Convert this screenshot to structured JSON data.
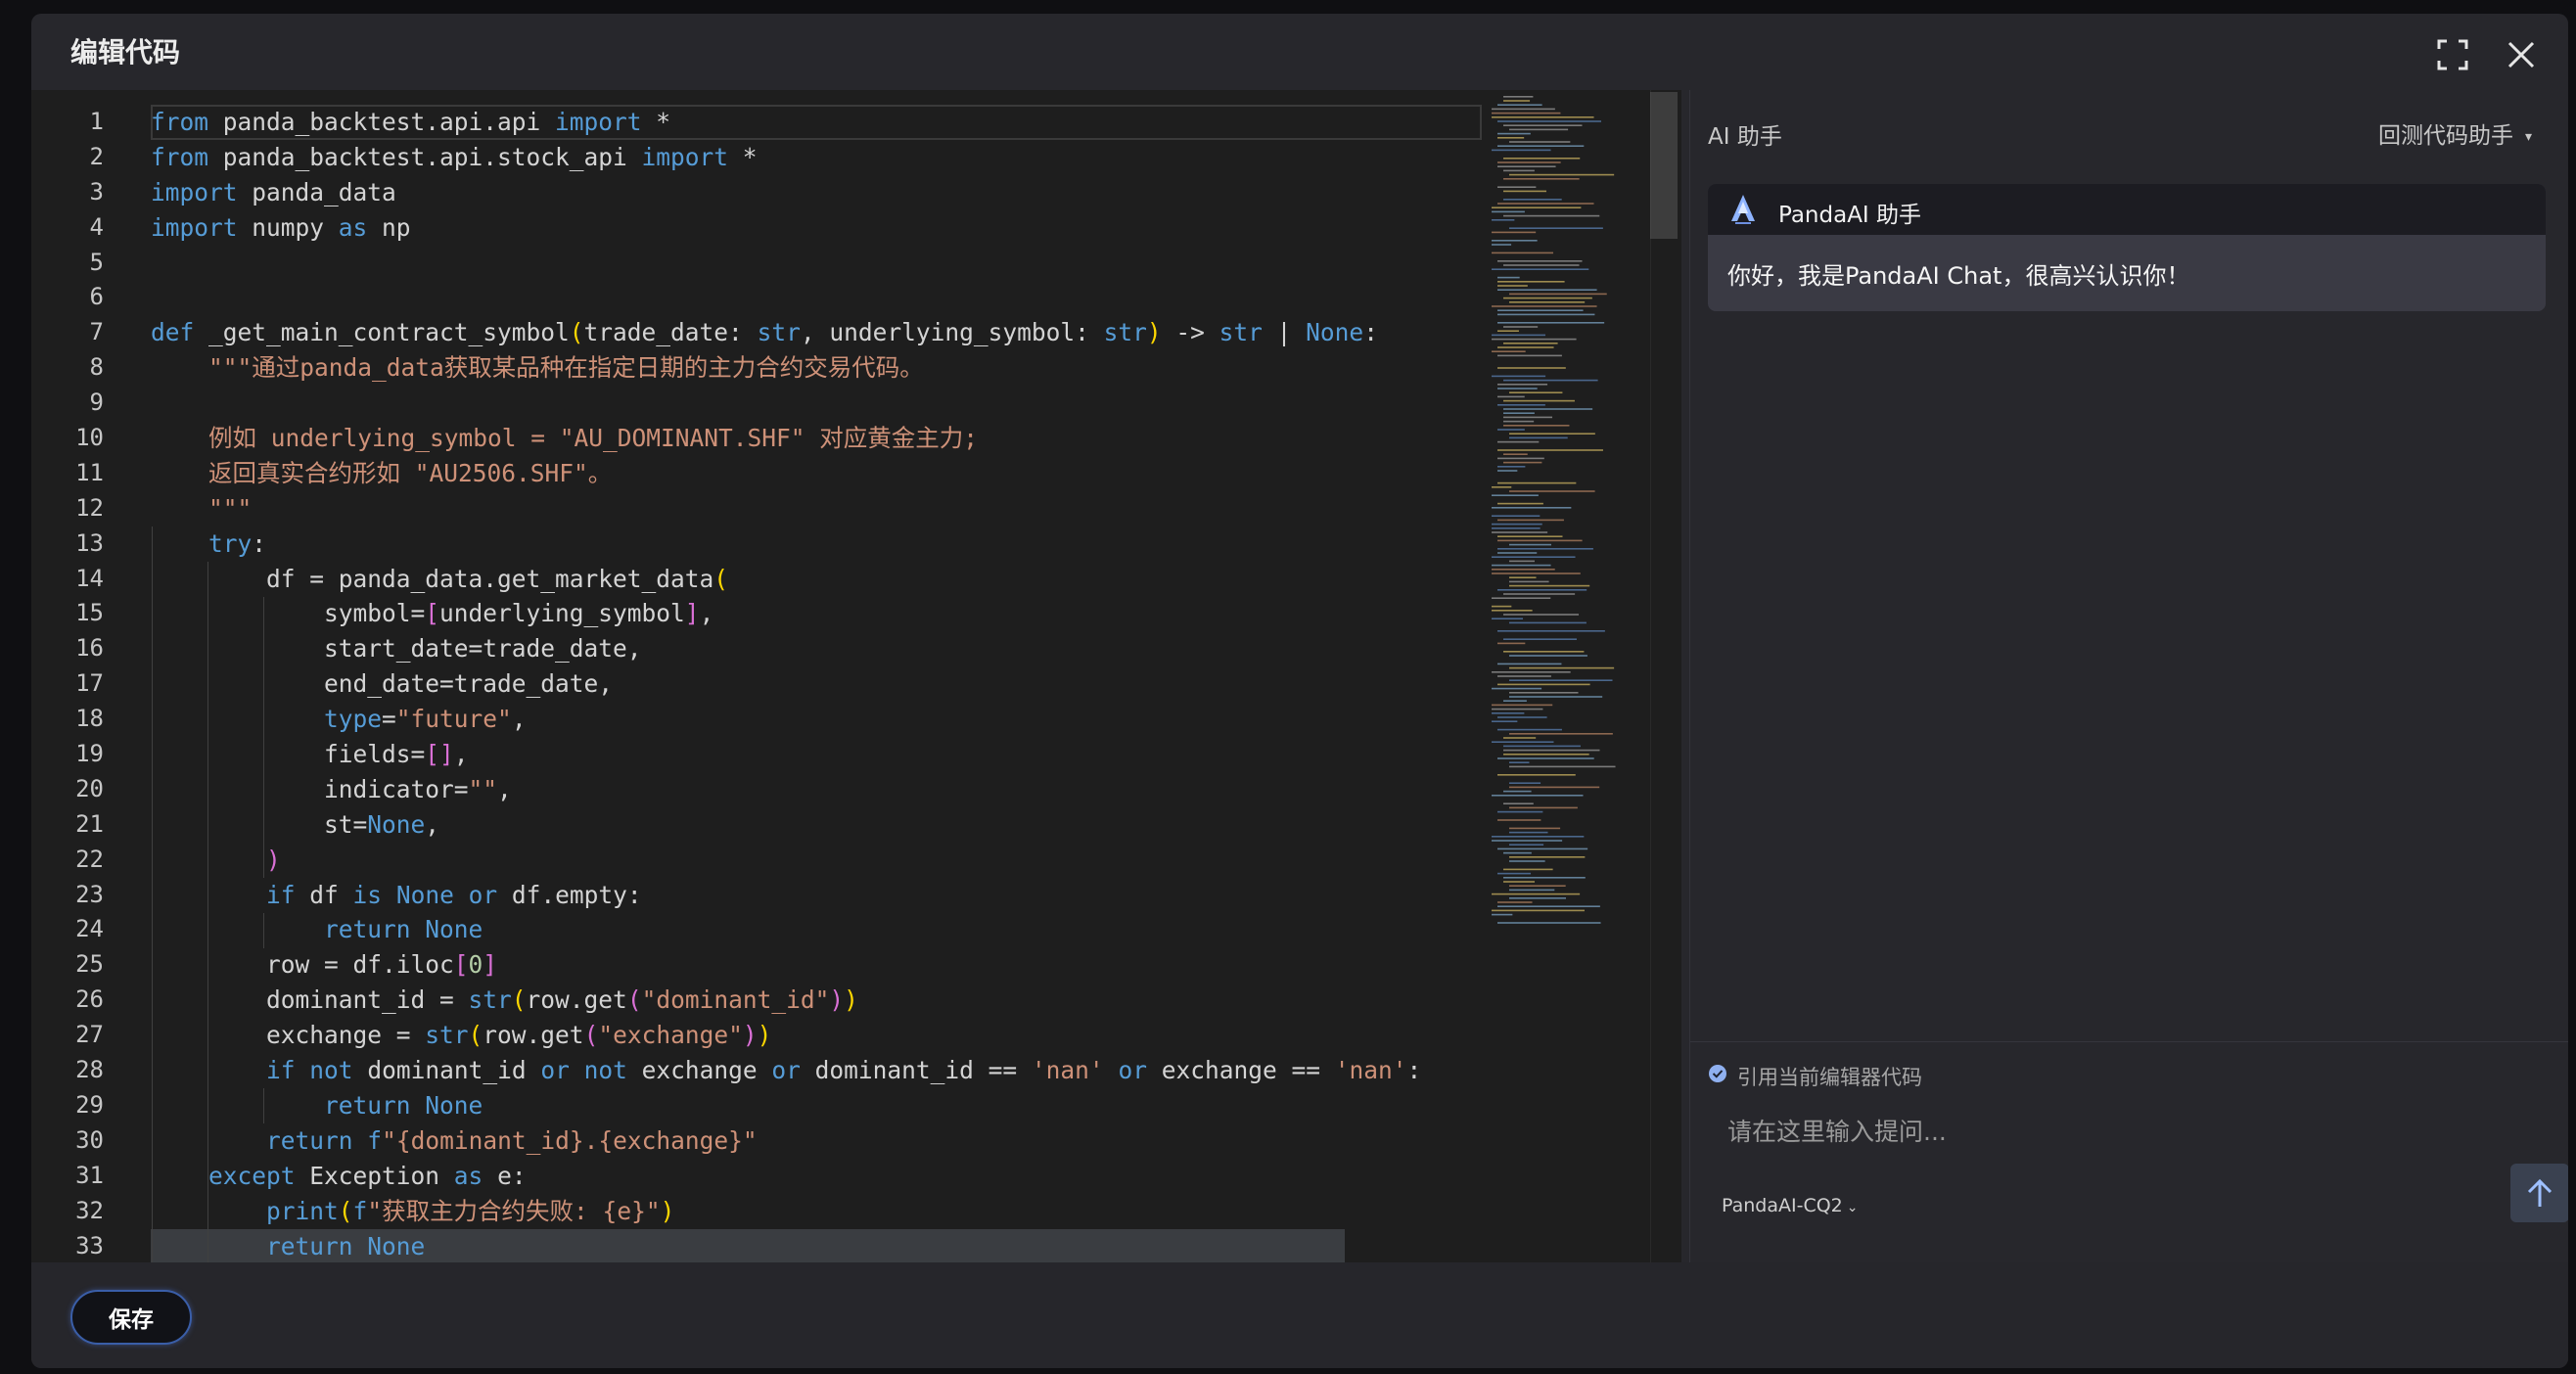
{
  "modal": {
    "title": "编辑代码"
  },
  "editor": {
    "line_numbers": [
      "1",
      "2",
      "3",
      "4",
      "5",
      "6",
      "7",
      "8",
      "9",
      "10",
      "11",
      "12",
      "13",
      "14",
      "15",
      "16",
      "17",
      "18",
      "19",
      "20",
      "21",
      "22",
      "23",
      "24",
      "25",
      "26",
      "27",
      "28",
      "29",
      "30",
      "31",
      "32",
      "33"
    ],
    "lines": [
      "from panda_backtest.api.api import *",
      "from panda_backtest.api.stock_api import *",
      "import panda_data",
      "import numpy as np",
      "",
      "",
      "def _get_main_contract_symbol(trade_date: str, underlying_symbol: str) -> str | None:",
      "    \"\"\"通过panda_data获取某品种在指定日期的主力合约交易代码。",
      "",
      "    例如 underlying_symbol = \"AU_DOMINANT.SHF\" 对应黄金主力;",
      "    返回真实合约形如 \"AU2506.SHF\"。",
      "    \"\"\"",
      "    try:",
      "        df = panda_data.get_market_data(",
      "            symbol=[underlying_symbol],",
      "            start_date=trade_date,",
      "            end_date=trade_date,",
      "            type=\"future\",",
      "            fields=[],",
      "            indicator=\"\",",
      "            st=None,",
      "        )",
      "        if df is None or df.empty:",
      "            return None",
      "        row = df.iloc[0]",
      "        dominant_id = str(row.get(\"dominant_id\"))",
      "        exchange = str(row.get(\"exchange\"))",
      "        if not dominant_id or not exchange or dominant_id == 'nan' or exchange == 'nan':",
      "            return None",
      "        return f\"{dominant_id}.{exchange}\"",
      "    except Exception as e:",
      "        print(f\"获取主力合约失败: {e}\")",
      "        return None"
    ]
  },
  "ai": {
    "title": "AI 助手",
    "mode_label": "回测代码助手",
    "assistant_name": "PandaAI 助手",
    "greeting": "你好，我是PandaAI Chat，很高兴认识你！",
    "reference_label": "引用当前编辑器代码",
    "reference_checked": true,
    "input_placeholder": "请在这里输入提问...",
    "model_name": "PandaAI-CQ2",
    "accent_color": "#3a5ea8"
  },
  "footer": {
    "save_label": "保存"
  },
  "icons": {
    "fullscreen": "fullscreen-icon",
    "close": "close-icon",
    "send": "arrow-up-icon",
    "assistant": "panda-logo-icon"
  }
}
